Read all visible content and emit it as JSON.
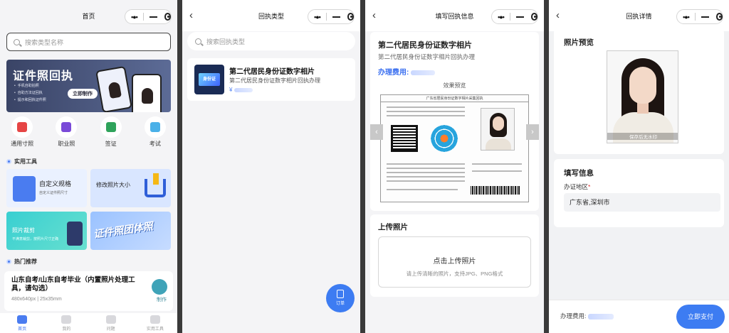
{
  "home": {
    "title": "首页",
    "search_placeholder": "搜索类型名称",
    "banner": {
      "title": "证件照回执",
      "bullets": [
        "手机自助拍照",
        "自助方法证回执",
        "提示和回执证件照"
      ],
      "button": "立即制作"
    },
    "categories": [
      "通用寸照",
      "职业照",
      "签证",
      "考试"
    ],
    "section_tools": "实用工具",
    "tools": [
      {
        "title": "自定义规格",
        "subtitle": "自定义证件照尺寸"
      },
      {
        "title": "修改照片大小",
        "subtitle": ""
      },
      {
        "title": "照片裁剪",
        "subtitle": "不满意裁剪，按照片尺寸正确"
      },
      {
        "title": "证件照团体照",
        "subtitle": ""
      }
    ],
    "section_hot": "热门推荐",
    "hot_item": {
      "title": "山东自考/山东自考毕业（内置照片处理工具，请勾选）",
      "spec": "480x640px | 25x35mm",
      "action": "制作"
    },
    "tabs": [
      "首页",
      "我的",
      "问题",
      "实用工具"
    ]
  },
  "receipt_types": {
    "title": "回执类型",
    "search_placeholder": "搜索回执类型",
    "item": {
      "badge": "身份证",
      "title": "第二代居民身份证数字相片",
      "subtitle": "第二代居民身份证数字相片回执办理",
      "price_symbol": "¥"
    },
    "fab": "订单"
  },
  "fill_info": {
    "title": "填写回执信息",
    "product_title": "第二代居民身份证数字相片",
    "product_subtitle": "第二代居民身份证数字相片回执办理",
    "fee_label": "办理费用:",
    "preview_label": "效果预览",
    "form_header": "广东省居民身份证数字相片采集回执",
    "upload_title": "上传照片",
    "upload_main": "点击上传照片",
    "upload_hint": "请上传清晰的照片，支持JPG、PNG格式"
  },
  "details": {
    "title": "回执详情",
    "photo_title": "照片预览",
    "watermark": "保存后无水印",
    "fill_title": "填写信息",
    "region_label": "办证地区",
    "required_mark": "*",
    "region_value": "广东省,深圳市",
    "fee_label": "办理费用:",
    "pay_button": "立即支付"
  },
  "capsule_dots": "•●•"
}
